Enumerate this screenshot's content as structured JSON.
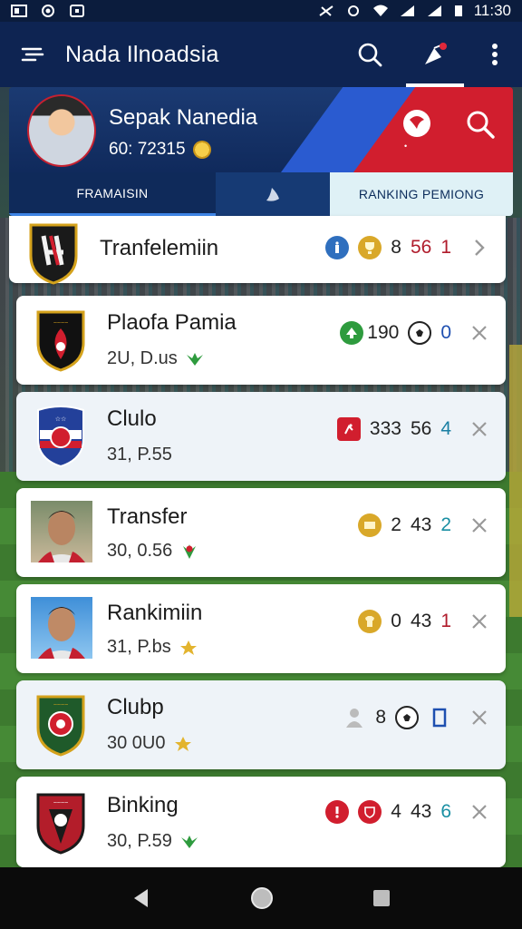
{
  "status": {
    "time": "11:30"
  },
  "app_bar": {
    "title": "Nada Ilnoadsia"
  },
  "header": {
    "name": "Sepak Nanedia",
    "sub": "60: 72315",
    "tabs": [
      "FRAMAISIN",
      "",
      "RANKING PEMIONG"
    ]
  },
  "list": [
    {
      "name": "Tranfelemiin",
      "sub": "",
      "stats": [
        "8",
        "56",
        "1"
      ],
      "stat_colors": [
        "#222",
        "#b01c2c",
        "#b01c2c"
      ],
      "trail": "chevron"
    },
    {
      "name": "Plaofa Pamia",
      "sub": "2U, D.us",
      "stats": [
        "190",
        "0"
      ],
      "stat_colors": [
        "#222",
        "#1e4fb0"
      ],
      "trail": "x"
    },
    {
      "name": "Clulo",
      "sub": "31, P.55",
      "stats": [
        "333",
        "56",
        "4"
      ],
      "stat_colors": [
        "#222",
        "#222",
        "#1a7fa3"
      ],
      "trail": "x"
    },
    {
      "name": "Transfer",
      "sub": "30, 0.56",
      "stats": [
        "2",
        "43",
        "2"
      ],
      "stat_colors": [
        "#222",
        "#222",
        "#1a8fa3"
      ],
      "trail": "x"
    },
    {
      "name": "Rankimiin",
      "sub": "31, P.bs",
      "stats": [
        "0",
        "43",
        "1"
      ],
      "stat_colors": [
        "#222",
        "#222",
        "#b01c2c"
      ],
      "trail": "x"
    },
    {
      "name": "Clubp",
      "sub": "30 0U0",
      "stats": [
        "8"
      ],
      "stat_colors": [
        "#222"
      ],
      "trail": "x"
    },
    {
      "name": "Binking",
      "sub": "30, P.59",
      "stats": [
        "4",
        "43",
        "6"
      ],
      "stat_colors": [
        "#222",
        "#222",
        "#1a8fa3"
      ],
      "trail": "x"
    }
  ],
  "colors": {
    "navy": "#0e2452",
    "red": "#d11e2e",
    "accent": "#3f86e8"
  }
}
